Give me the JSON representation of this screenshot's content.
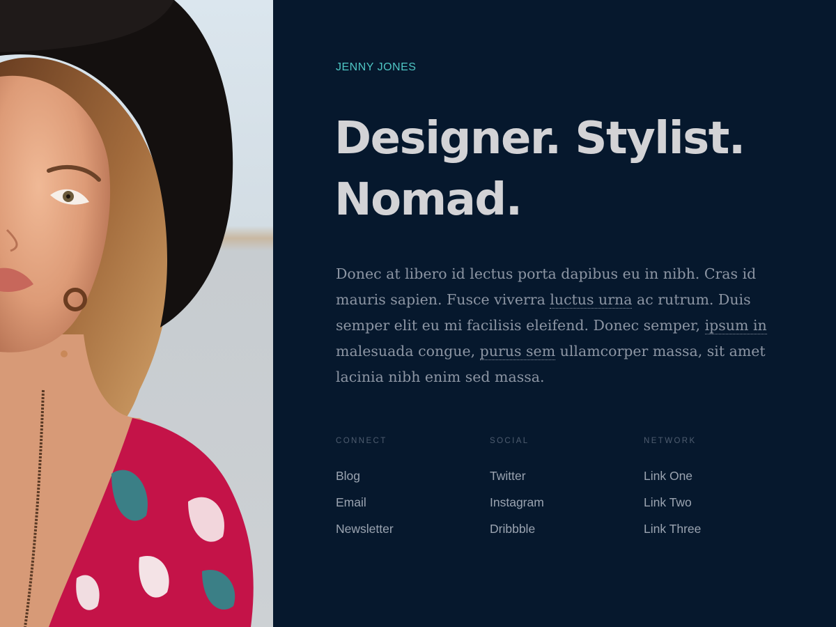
{
  "profile": {
    "name": "JENNY JONES",
    "headline_line1": "Designer. Stylist.",
    "headline_line2": "Nomad.",
    "photo": "woman-in-black-hat-portrait"
  },
  "bio": {
    "seg1": "Donec at libero id lectus porta dapibus eu in nibh. Cras id mauris sapien. Fusce viverra ",
    "link1": "luctus urna",
    "seg2": " ac rutrum. Duis semper elit eu mi facilisis eleifend. Donec semper, ",
    "link2": "ipsum in",
    "seg3": " malesuada congue, ",
    "link3": "purus sem",
    "seg4": " ullamcorper massa, sit amet lacinia nibh enim sed massa."
  },
  "columns": [
    {
      "heading": "CONNECT",
      "links": [
        "Blog",
        "Email",
        "Newsletter"
      ]
    },
    {
      "heading": "SOCIAL",
      "links": [
        "Twitter",
        "Instagram",
        "Dribbble"
      ]
    },
    {
      "heading": "NETWORK",
      "links": [
        "Link One",
        "Link Two",
        "Link Three"
      ]
    }
  ],
  "colors": {
    "panel_bg": "#06182d",
    "accent": "#4fc6c4",
    "headline": "#d3d3d6",
    "body_text": "#8c95a3"
  }
}
